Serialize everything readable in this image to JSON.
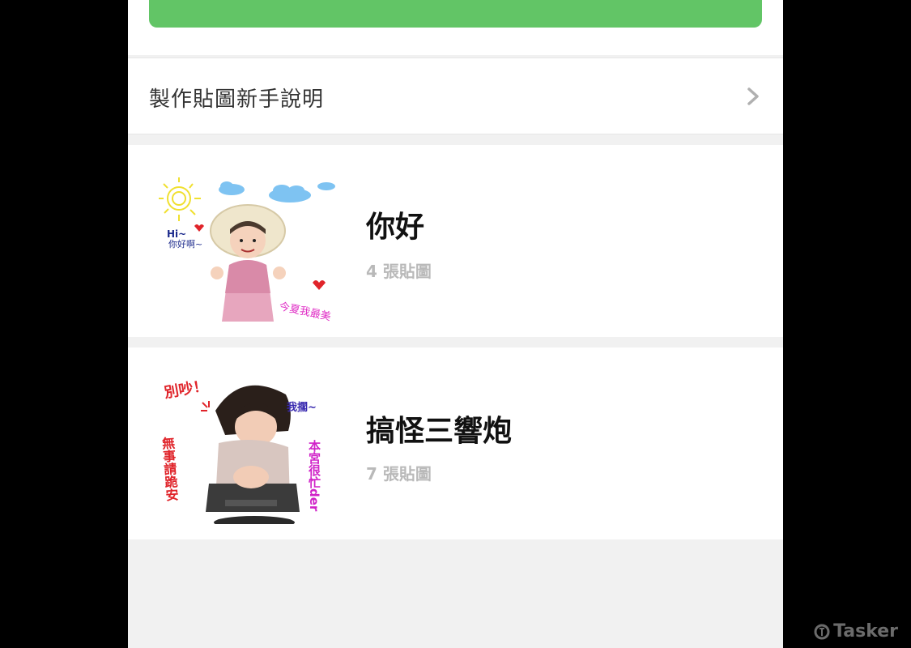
{
  "top": {
    "primary_button_label": ""
  },
  "guide": {
    "label": "製作貼圖新手說明",
    "chevron": "chevron-right-icon"
  },
  "sticker_sets": [
    {
      "title": "你好",
      "count": "4 張貼圖",
      "thumbnail": {
        "greeting": "Hi~",
        "greeting_sub": "你好啊~",
        "caption": "今夏我最美"
      }
    },
    {
      "title": "搞怪三響炮",
      "count": "7 張貼圖",
      "thumbnail": {
        "label_top": "別吵！",
        "label_right_top": "我擱~",
        "label_left": "無事請跪安",
        "label_right": "本宮很忙der"
      }
    }
  ],
  "watermark": "Tasker",
  "colors": {
    "green": "#62c566",
    "bg": "#f1f1f1",
    "count": "#b9b9b9"
  }
}
